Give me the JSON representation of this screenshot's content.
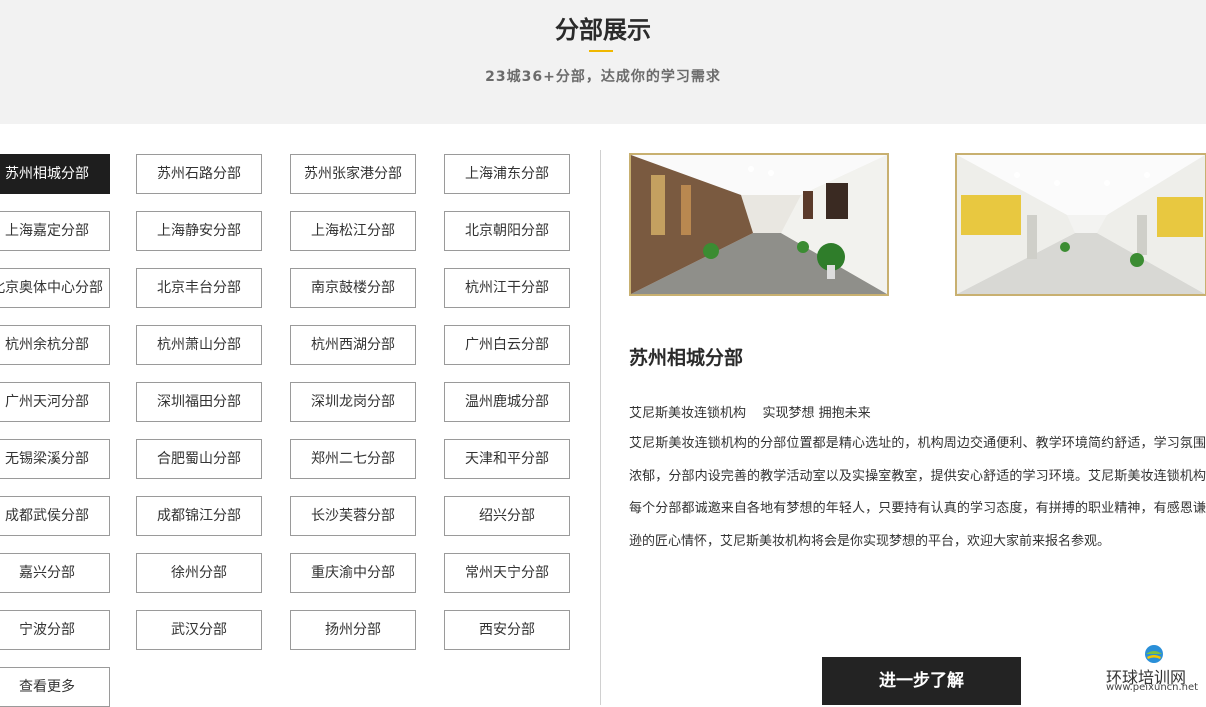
{
  "header": {
    "title": "分部展示",
    "subtitle": "23城36+分部，达成你的学习需求"
  },
  "branches": [
    {
      "label": "苏州相城分部",
      "active": true
    },
    {
      "label": "苏州石路分部"
    },
    {
      "label": "苏州张家港分部"
    },
    {
      "label": "上海浦东分部"
    },
    {
      "label": "上海嘉定分部"
    },
    {
      "label": "上海静安分部"
    },
    {
      "label": "上海松江分部"
    },
    {
      "label": "北京朝阳分部"
    },
    {
      "label": "北京奥体中心分部"
    },
    {
      "label": "北京丰台分部"
    },
    {
      "label": "南京鼓楼分部"
    },
    {
      "label": "杭州江干分部"
    },
    {
      "label": "杭州余杭分部"
    },
    {
      "label": "杭州萧山分部"
    },
    {
      "label": "杭州西湖分部"
    },
    {
      "label": "广州白云分部"
    },
    {
      "label": "广州天河分部"
    },
    {
      "label": "深圳福田分部"
    },
    {
      "label": "深圳龙岗分部"
    },
    {
      "label": "温州鹿城分部"
    },
    {
      "label": "无锡梁溪分部"
    },
    {
      "label": "合肥蜀山分部"
    },
    {
      "label": "郑州二七分部"
    },
    {
      "label": "天津和平分部"
    },
    {
      "label": "成都武侯分部"
    },
    {
      "label": "成都锦江分部"
    },
    {
      "label": "长沙芙蓉分部"
    },
    {
      "label": "绍兴分部"
    },
    {
      "label": "嘉兴分部"
    },
    {
      "label": "徐州分部"
    },
    {
      "label": "重庆渝中分部"
    },
    {
      "label": "常州天宁分部"
    },
    {
      "label": "宁波分部"
    },
    {
      "label": "武汉分部"
    },
    {
      "label": "扬州分部"
    },
    {
      "label": "西安分部"
    },
    {
      "label": "查看更多"
    }
  ],
  "detail": {
    "title": "苏州相城分部",
    "slogan": "艾尼斯美妆连锁机构    实现梦想 拥抱未来",
    "description": "艾尼斯美妆连锁机构的分部位置都是精心选址的，机构周边交通便利、教学环境简约舒适，学习氛围浓郁，分部内设完善的教学活动室以及实操室教室，提供安心舒适的学习环境。艾尼斯美妆连锁机构每个分部都诚邀来自各地有梦想的年轻人，只要持有认真的学习态度，有拼搏的职业精神，有感恩谦逊的匠心情怀，艾尼斯美妆机构将会是你实现梦想的平台，欢迎大家前来报名参观。",
    "button_label": "进一步了解"
  },
  "watermark": {
    "name": "环球培训网",
    "url": "www.peixuncn.net"
  },
  "colors": {
    "accent": "#f0b800",
    "active_bg": "#1e1e1e",
    "photo_frame": "#c8b070"
  }
}
